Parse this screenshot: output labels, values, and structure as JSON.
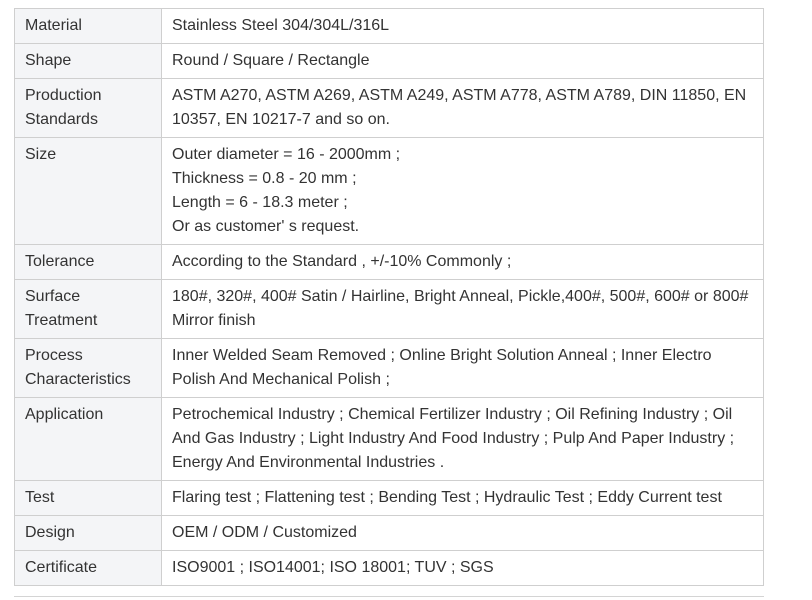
{
  "spec_table": {
    "rows": [
      {
        "label": "Material",
        "value": "Stainless Steel 304/304L/316L"
      },
      {
        "label": "Shape",
        "value": "Round / Square / Rectangle"
      },
      {
        "label": "Production\nStandards",
        "value": "ASTM A270, ASTM A269, ASTM A249, ASTM A778, ASTM A789, DIN 11850, EN\n10357, EN 10217-7 and so on."
      },
      {
        "label": "Size",
        "value": "Outer diameter = 16 - 2000mm ;\nThickness = 0.8 - 20 mm ;\nLength = 6 - 18.3 meter ;\nOr as customer' s request."
      },
      {
        "label": "Tolerance",
        "value": "According to the Standard , +/-10% Commonly ;"
      },
      {
        "label": "Surface\nTreatment",
        "value": "180#, 320#, 400# Satin / Hairline, Bright Anneal, Pickle,400#, 500#, 600# or 800#\nMirror finish"
      },
      {
        "label": "Process\nCharacteristics",
        "value": "Inner Welded Seam Removed ; Online Bright Solution Anneal ; Inner Electro\nPolish And Mechanical Polish ;"
      },
      {
        "label": "Application",
        "value": "Petrochemical Industry ; Chemical Fertilizer Industry ; Oil Refining Industry ; Oil\nAnd Gas Industry ; Light Industry And Food Industry ; Pulp And Paper Industry ;\nEnergy And Environmental Industries ."
      },
      {
        "label": "Test",
        "value": "Flaring test ; Flattening test ; Bending Test ; Hydraulic Test ; Eddy Current test"
      },
      {
        "label": "Design",
        "value": "OEM / ODM / Customized"
      },
      {
        "label": "Certificate",
        "value": "ISO9001 ; ISO14001; ISO 18001; TUV ; SGS"
      }
    ]
  }
}
